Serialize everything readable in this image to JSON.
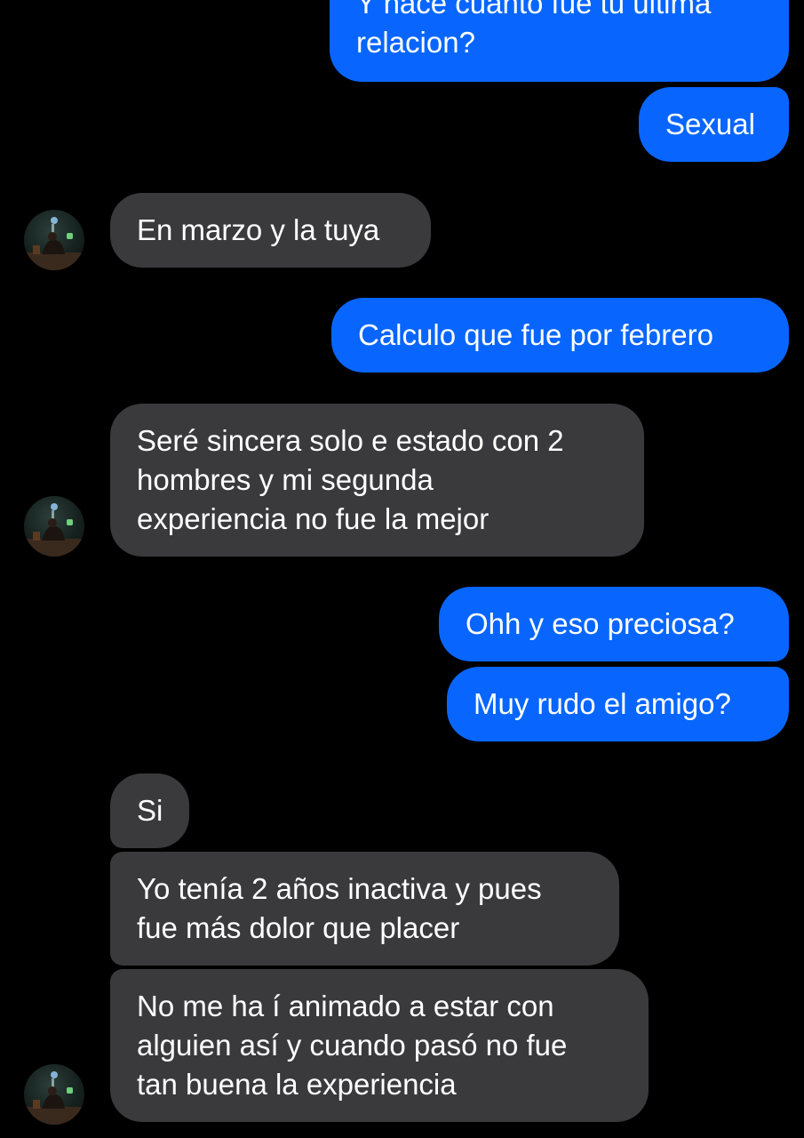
{
  "colors": {
    "background": "#000000",
    "sent_bubble": "#0866ff",
    "received_bubble": "#3a3a3c",
    "text": "#ffffff"
  },
  "avatar": {
    "icon": "profile-photo-avatar"
  },
  "messages": [
    {
      "id": "m1",
      "direction": "sent",
      "text": "Y hace cuanto fue tu ultima\nrelacion?"
    },
    {
      "id": "m2",
      "direction": "sent",
      "text": "Sexual"
    },
    {
      "id": "m3",
      "direction": "received",
      "text": "En marzo y la tuya"
    },
    {
      "id": "m4",
      "direction": "sent",
      "text": "Calculo que fue por febrero"
    },
    {
      "id": "m5",
      "direction": "received",
      "text": "Seré sincera solo e estado con 2\nhombres y mi segunda\nexperiencia no fue la mejor"
    },
    {
      "id": "m6",
      "direction": "sent",
      "text": "Ohh y eso preciosa?"
    },
    {
      "id": "m7",
      "direction": "sent",
      "text": "Muy rudo el amigo?"
    },
    {
      "id": "m8",
      "direction": "received",
      "text": "Si"
    },
    {
      "id": "m9",
      "direction": "received",
      "text": "Yo tenía 2 años inactiva y pues\nfue más dolor que placer"
    },
    {
      "id": "m10",
      "direction": "received",
      "text": "No me ha í animado a estar con\nalguien así y cuando pasó no fue\ntan buena la experiencia"
    }
  ]
}
